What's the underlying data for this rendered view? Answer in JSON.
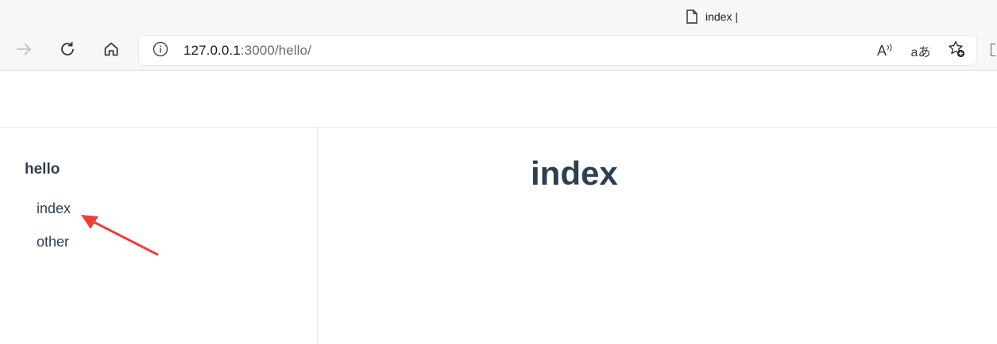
{
  "browser": {
    "tab_title": "index |",
    "url_host": "127.0.0.1",
    "url_rest": ":3000/hello/",
    "icons": {
      "tab": "page-icon",
      "back": "arrow-right-icon",
      "reload": "reload-icon",
      "home": "home-icon",
      "info": "info-icon",
      "read_aloud": "read-aloud-icon",
      "translate": "translate-icon",
      "favorites": "add-favorite-icon"
    },
    "read_aloud_label": "A",
    "translate_label": "aあ"
  },
  "sidebar": {
    "heading": "hello",
    "links": [
      {
        "label": "index",
        "active": true
      },
      {
        "label": "other",
        "active": false
      }
    ]
  },
  "content": {
    "title": "index"
  },
  "annotation": {
    "color": "#e8403a"
  }
}
